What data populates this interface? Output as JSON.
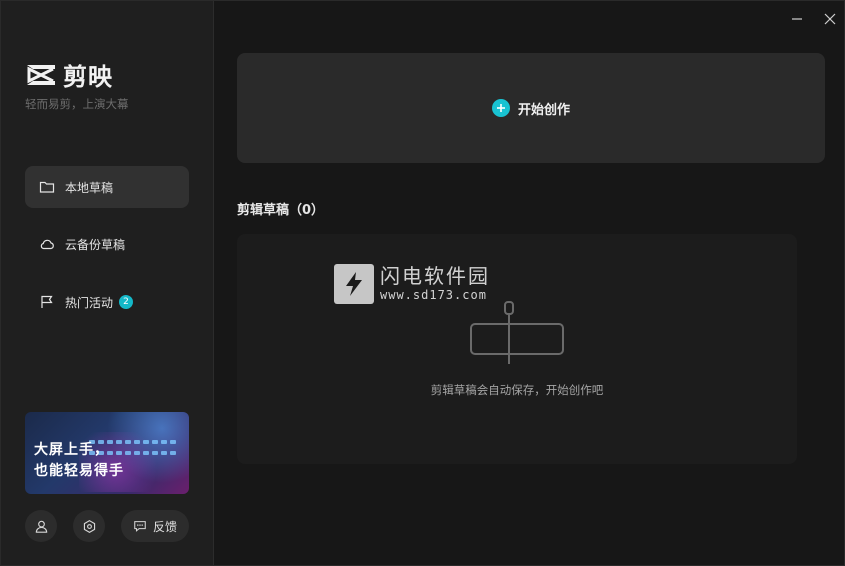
{
  "app": {
    "name": "剪映",
    "slogan": "轻而易剪，上演大幕"
  },
  "sidebar": {
    "items": [
      {
        "label": "本地草稿",
        "icon": "folder-icon",
        "active": true
      },
      {
        "label": "云备份草稿",
        "icon": "cloud-icon",
        "active": false
      },
      {
        "label": "热门活动",
        "icon": "flag-icon",
        "active": false,
        "badge": "2"
      }
    ],
    "promo": {
      "line1": "大屏上手，",
      "line2": "也能轻易得手"
    },
    "footer": {
      "profile_icon": "user-icon",
      "settings_icon": "settings-icon",
      "feedback_label": "反馈"
    }
  },
  "main": {
    "create_label": "开始创作",
    "drafts_title": "剪辑草稿（0）",
    "empty_text": "剪辑草稿会自动保存，开始创作吧"
  },
  "watermark": {
    "title": "闪电软件园",
    "url": "www.sd173.com"
  },
  "colors": {
    "accent": "#19c3d2",
    "sidebar_bg": "#1f1f1f",
    "main_bg": "#171717"
  }
}
